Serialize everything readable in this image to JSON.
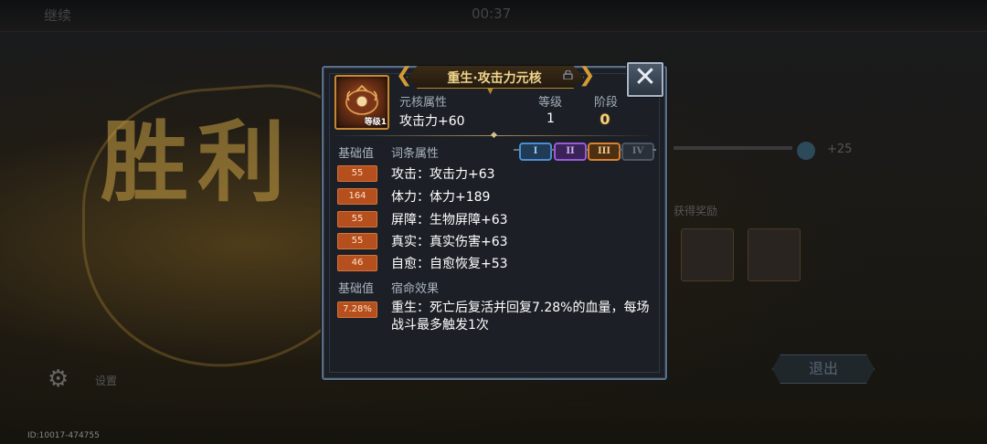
{
  "background": {
    "top_left_text": "继续",
    "timer": "00:37",
    "victory_text": "胜利",
    "rewards_label": "获得奖励",
    "plus_value": "+25",
    "exit_label": "退出",
    "settings_label": "设置",
    "id_text": "ID:10017-474755"
  },
  "popup": {
    "title": "重生·攻击力元核",
    "close_icon": "close-icon",
    "core": {
      "icon": "rebirth-core-icon",
      "level_badge": "等级1",
      "attr_label": "元核属性",
      "attr_value": "攻击力+60",
      "level_label": "等级",
      "level_value": "1",
      "stage_label": "阶段",
      "stage_value": "0"
    },
    "affix_section": {
      "base_label": "基础值",
      "title": "词条属性",
      "tiers": [
        {
          "label": "I",
          "color": "#4a8fd6"
        },
        {
          "label": "II",
          "color": "#9b5ad8"
        },
        {
          "label": "III",
          "color": "#d9822f"
        },
        {
          "label": "IV",
          "color": "#5b6470"
        }
      ],
      "rows": [
        {
          "base": "55",
          "text": "攻击：攻击力+63"
        },
        {
          "base": "164",
          "text": "体力：体力+189"
        },
        {
          "base": "55",
          "text": "屏障：生物屏障+63"
        },
        {
          "base": "55",
          "text": "真实：真实伤害+63"
        },
        {
          "base": "46",
          "text": "自愈：自愈恢复+53"
        }
      ]
    },
    "fate_section": {
      "base_label": "基础值",
      "title": "宿命效果",
      "base_value": "7.28%",
      "text": "重生：死亡后复活并回复7.28%的血量，每场战斗最多触发1次"
    }
  }
}
